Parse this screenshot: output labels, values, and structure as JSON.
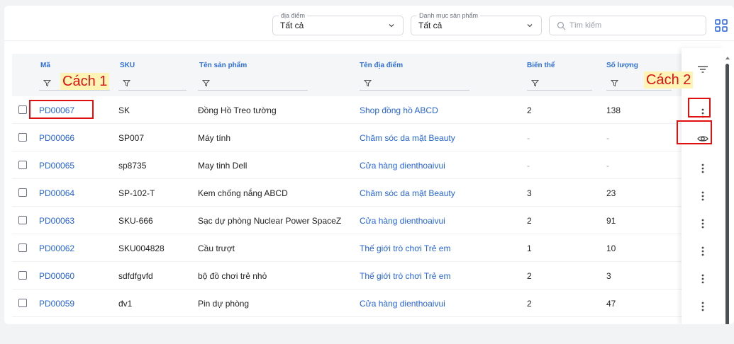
{
  "filters": {
    "location": {
      "label": "địa điểm",
      "value": "Tất cả"
    },
    "category": {
      "label": "Danh mục sản phẩm",
      "value": "Tất cả"
    },
    "search_placeholder": "Tìm kiếm"
  },
  "columns": {
    "code": "Mã",
    "sku": "SKU",
    "name": "Tên sản phẩm",
    "location": "Tên địa điểm",
    "variant": "Biến thể",
    "qty": "Số lượng"
  },
  "rows": [
    {
      "code": "PD00067",
      "sku": "SK",
      "name": "Đồng Hồ Treo tường",
      "location": "Shop đồng hồ ABCD",
      "variant": "2",
      "qty": "138"
    },
    {
      "code": "PD00066",
      "sku": "SP007",
      "name": "Máy tính",
      "location": "Chăm sóc da mặt Beauty",
      "variant": "-",
      "qty": "-"
    },
    {
      "code": "PD00065",
      "sku": "sp8735",
      "name": "May tinh Dell",
      "location": "Cửa hàng dienthoaivui",
      "variant": "-",
      "qty": "-"
    },
    {
      "code": "PD00064",
      "sku": "SP-102-T",
      "name": "Kem chống nắng ABCD",
      "location": "Chăm sóc da mặt Beauty",
      "variant": "3",
      "qty": "23"
    },
    {
      "code": "PD00063",
      "sku": "SKU-666",
      "name": "Sạc dự phòng Nuclear Power SpaceZ",
      "location": "Cửa hàng dienthoaivui",
      "variant": "2",
      "qty": "91"
    },
    {
      "code": "PD00062",
      "sku": "SKU004828",
      "name": "Cầu trượt",
      "location": "Thế giới trò chơi Trẻ em",
      "variant": "1",
      "qty": "10"
    },
    {
      "code": "PD00060",
      "sku": "sdfdfgvfd",
      "name": "bộ đồ chơi trẻ nhỏ",
      "location": "Thế giới trò chơi Trẻ em",
      "variant": "2",
      "qty": "3"
    },
    {
      "code": "PD00059",
      "sku": "đv1",
      "name": "Pin dự phòng",
      "location": "Cửa hàng dienthoaivui",
      "variant": "2",
      "qty": "47"
    }
  ],
  "annotations": {
    "way1": "Cách 1",
    "way2": "Cách 2"
  },
  "icons": {
    "dropdown": "chevron-down-icon",
    "search": "search-icon",
    "grid": "grid-view-icon",
    "column_filter": "filter-icon",
    "column_settings": "column-settings-icon",
    "row_actions": "more-vertical-icon",
    "view": "eye-icon"
  },
  "colors": {
    "link": "#2563d9",
    "header_text": "#2f6fd6",
    "annotation_text": "#d11111",
    "annotation_bg": "#fdf4b6",
    "highlight_box": "#e01010"
  }
}
